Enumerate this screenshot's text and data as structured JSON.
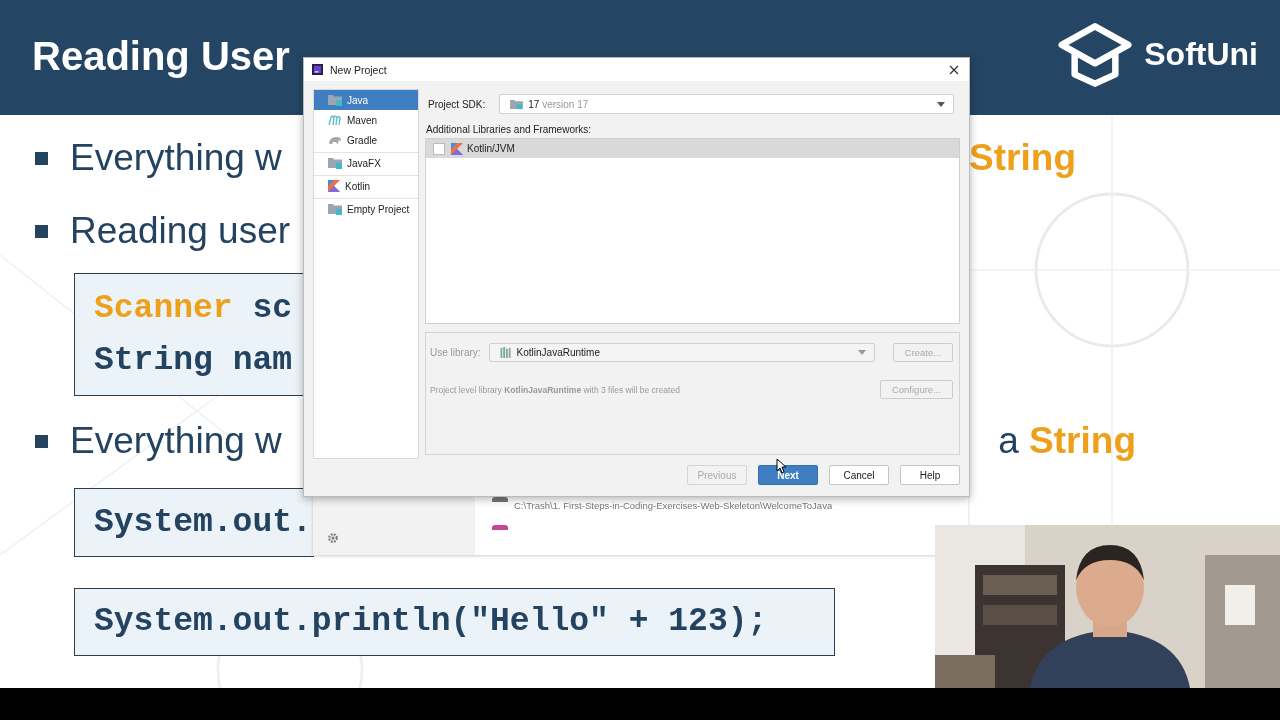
{
  "slide": {
    "title": "Reading User",
    "logo_text": "SoftUni",
    "blocks": [
      {
        "kind": "bullet",
        "text": "Everything w",
        "right": [
          {
            "text": "String",
            "highlight": true
          }
        ]
      },
      {
        "kind": "bullet",
        "text": "Reading user"
      },
      {
        "kind": "code",
        "cut": true,
        "lines": [
          [
            {
              "text": "Scanner",
              "highlight": true
            },
            {
              "text": "sc",
              "highlight": false
            }
          ],
          [
            {
              "text": "String",
              "highlight": false
            },
            {
              "text": "nam",
              "highlight": false
            }
          ]
        ]
      },
      {
        "kind": "bullet",
        "text": "Everything w",
        "right": [
          {
            "text": "a",
            "highlight": false
          },
          {
            "text": "String",
            "highlight": true
          }
        ]
      },
      {
        "kind": "code",
        "cut": true,
        "lines": [
          [
            {
              "text": "System.out.",
              "highlight": false
            }
          ]
        ]
      },
      {
        "kind": "code",
        "cut": false,
        "lines": [
          [
            {
              "text": "System.out.println(\"Hello\" + 123);",
              "highlight": false
            }
          ]
        ]
      }
    ]
  },
  "background_window": {
    "path": "C:\\Trash\\1. First-Steps-in-Coding-Exercises-Web-Skeleton\\WelcomeToJava"
  },
  "dialog": {
    "title": "New Project",
    "project_type_groups": [
      [
        {
          "label": "Java",
          "selected": true
        },
        {
          "label": "Maven",
          "selected": false
        },
        {
          "label": "Gradle",
          "selected": false
        }
      ],
      [
        {
          "label": "JavaFX",
          "selected": false
        }
      ],
      [
        {
          "label": "Kotlin",
          "selected": false
        }
      ],
      [
        {
          "label": "Empty Project",
          "selected": false
        }
      ]
    ],
    "sdk": {
      "label": "Project SDK:",
      "value": "17",
      "detail": "version 17"
    },
    "frameworks": {
      "label": "Additional Libraries and Frameworks:",
      "items": [
        {
          "label": "Kotlin/JVM",
          "checked": false,
          "selected": true
        }
      ]
    },
    "library": {
      "label": "Use library:",
      "value": "KotlinJavaRuntime",
      "disabled": true,
      "create_button": {
        "label": "Create...",
        "disabled": true
      },
      "note": "Project level library **KotlinJavaRuntime** with 3 files will be created",
      "configure_button": {
        "label": "Configure...",
        "disabled": true
      }
    },
    "buttons": [
      {
        "label": "Previous",
        "disabled": true,
        "primary": false
      },
      {
        "label": "Next",
        "disabled": false,
        "primary": true
      },
      {
        "label": "Cancel",
        "disabled": false,
        "primary": false
      },
      {
        "label": "Help",
        "disabled": false,
        "primary": false
      }
    ]
  }
}
